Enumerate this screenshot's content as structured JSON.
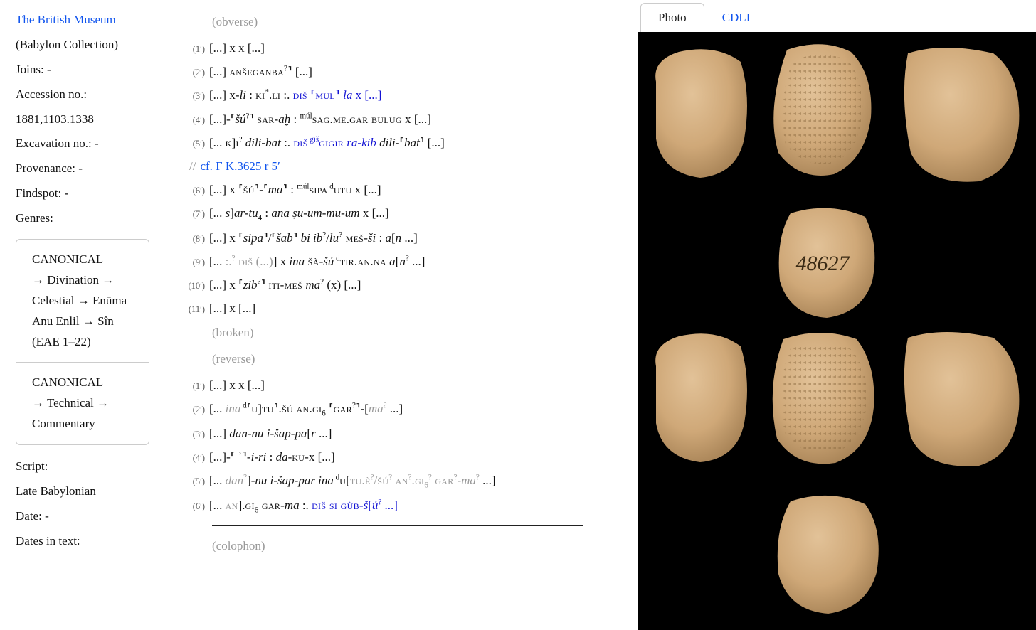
{
  "sidebar": {
    "museum": "The British Museum",
    "collection": "(Babylon Collection)",
    "joins_label": "Joins:",
    "joins_value": "-",
    "accession_label": "Accession no.:",
    "accession_value": "1881,1103.1338",
    "excavation_label": "Excavation no.:",
    "excavation_value": "-",
    "provenance_label": "Provenance:",
    "provenance_value": "-",
    "findspot_label": "Findspot:",
    "findspot_value": "-",
    "genres_label": "Genres:",
    "genre1_head": "CANONICAL",
    "genre1_body": "→ Divination → Celestial → Enūma Anu Enlil → Sîn (EAE 1–22)",
    "genre2_head": "CANONICAL",
    "genre2_body": "→ Technical → Commentary",
    "script_label": "Script:",
    "script_value": "Late Babylonian",
    "date_label": "Date:",
    "date_value": "-",
    "dates_in_text_label": "Dates in text:"
  },
  "obverse_label": "(obverse)",
  "broken_label": "(broken)",
  "reverse_label": "(reverse)",
  "colophon_label": "(colophon)",
  "parallel_prefix": "//",
  "parallel_text": "cf. F K.3625 r 5′",
  "obv": {
    "n1": "(1′)",
    "n2": "(2′)",
    "n3": "(3′)",
    "n4": "(4′)",
    "n5": "(5′)",
    "n6": "(6′)",
    "n7": "(7′)",
    "n8": "(8′)",
    "n9": "(9′)",
    "n10": "(10′)",
    "n11": "(11′)"
  },
  "rev": {
    "n1": "(1′)",
    "n2": "(2′)",
    "n3": "(3′)",
    "n4": "(4′)",
    "n5": "(5′)",
    "n6": "(6′)"
  },
  "lines": {
    "o1_a": "[...] x x [...]",
    "o2_a": "[...] ",
    "o2_b": "anše",
    " o2_c": " : ⸢",
    "o2_d": "ganba",
    "o2_e": "?",
    "o2_f": "⸣ [...]",
    "o3_a": "[...] x-",
    "o3_b": "li",
    "o3_c": " : ",
    "o3_d": "ki",
    "o3_e": "*",
    "o3_f": ".",
    "o3_g": "li",
    "o3_h": " :. ",
    "o3_i": "diš ⸢mul⸣",
    "o3_j": " la",
    "o3_k": " x [...]",
    "o4_a": "[...]-⸢",
    "o4_b": "šú",
    "o4_c": "?",
    "o4_d": "⸣ ",
    "o4_e": "sar",
    "o4_f": "-",
    "o4_g": "aḫ",
    "o4_h": " : ",
    "o4_i": "múl",
    "o4_j": "sag.me.gar bulug",
    "o4_k": " x [...]",
    "o5_a": "[... ",
    "o5_b": "k",
    "o5_c": "]",
    "o5_d": "i",
    "o5_q": "?",
    "o5_e": " dili-bat",
    "o5_f": " :. ",
    "o5_g": "diš",
    "o5_h": " giš",
    "o5_i": "gigir",
    "o5_j": " ra-kib",
    "o5_k": " dili",
    "o5_l": "-⸢",
    "o5_m": "bat",
    "o5_n": "⸣ [...]",
    "o6_a": "[...] x ⸢",
    "o6_b": "šú",
    "o6_c": "⸣-⸢",
    "o6_d": "ma",
    "o6_e": "⸣ : ",
    "o6_f": "múl",
    "o6_g": "sipa",
    "o6_h": " d",
    "o6_i": "utu",
    "o6_j": " x [...]",
    "o7_a": "[... ",
    "o7_b": "s",
    "o7_c": "]",
    "o7_d": "ar-tu",
    "o7_e": "4",
    "o7_f": " : ",
    "o7_g": "ana ṣu-um-mu-um",
    "o7_h": " x [...]",
    "o8_a": "[...] x ⸢",
    "o8_b": "sipa",
    "o8_c": "⸣/⸢",
    "o8_d": "šab",
    "o8_e": "⸣ ",
    "o8_f": "bi ib",
    "o8_q1": "?",
    "o8_g": "/",
    "o8_h": "lu",
    "o8_q2": "?",
    "o8_i": " meš",
    "o8_j": "-",
    "o8_k": "ši",
    "o8_l": " : ",
    "o8_m": "a",
    "o8_n": "[",
    "o8_o": "n",
    "o8_p": " ...]",
    "o9_a": "[... ",
    "o9_g1": ":.",
    "o9_g2": "?",
    "o9_g3": " diš",
    "o9_g4": " (...)",
    "o9_b": "] x ",
    "o9_c": "ina",
    "o9_d": " šà",
    "o9_e": "-",
    "o9_f": "šú",
    "o9_h": " d",
    "o9_i": "tir.an.na",
    "o9_j": " a",
    "o9_k": "[",
    "o9_l": "n",
    "o9_q": "?",
    "o9_m": " ...]",
    "o10_a": "[...] x ⸢",
    "o10_b": "zib",
    "o10_q": "?",
    "o10_c": "⸣ ",
    "o10_d": "iti-meš",
    "o10_e": " ma",
    "o10_q2": "?",
    "o10_f": " (x) [...]",
    "o11_a": "[...] x [...]",
    "r1_a": "[...] x x [...]",
    "r2_a": "[... ",
    "r2_b": "ina",
    "r2_c": " d",
    "r2_d": "⸢",
    "r2_e": "u",
    "r2_f": "]",
    "r2_g": "tu⸣.šú an.gi",
    "r2_h": "6",
    "r2_i": " ⸢",
    "r2_j": "gar",
    "r2_q": "?",
    "r2_k": "⸣-[",
    "r2_l": "ma",
    "r2_q2": "?",
    "r2_m": " ...]",
    "r3_a": "[...] ",
    "r3_b": "dan-nu i-šap-pa",
    "r3_c": "[",
    "r3_d": "r",
    "r3_e": " ...]",
    "r4_a": "[...]-⸢ ",
    "r4_b": "ʾ",
    "r4_c": "⸣-",
    "r4_d": "i-ri",
    "r4_e": " : ",
    "r4_f": "da",
    "r4_g": "-",
    "r4_h": "ku",
    "r4_i": "-x [...]",
    "r5_a": "[... ",
    "r5_b": "dan",
    "r5_q": "?",
    "r5_c": "]-",
    "r5_d": "nu i-šap-par ina",
    "r5_e": " d",
    "r5_f": "u",
    "r5_g": "[",
    "r5_h": "tu.è",
    "r5_q2": "?",
    "r5_i": "/",
    "r5_j": "šú",
    "r5_q3": "?",
    "r5_k": " an",
    "r5_q4": "?",
    "r5_l": ".gi",
    "r5_m": "6",
    "r5_q5": "?",
    "r5_n": " gar",
    "r5_q6": "?",
    "r5_o": "-",
    "r5_p": "ma",
    "r5_q7": "?",
    "r5_r": " ...]",
    "r6_a": "[... ",
    "r6_b": "an",
    "r6_c": "].",
    "r6_d": "gi",
    "r6_e": "6",
    "r6_f": " gar",
    "r6_g": "-",
    "r6_h": "ma",
    "r6_i": " :. ",
    "r6_j": "diš si gùb",
    "r6_k": "-",
    "r6_l": "š",
    "r6_m": "[",
    "r6_n": "ú",
    "r6_q": "?",
    "r6_o": " ...]"
  },
  "tabs": {
    "photo": "Photo",
    "cdli": "CDLI"
  },
  "photo_mark": "48627"
}
